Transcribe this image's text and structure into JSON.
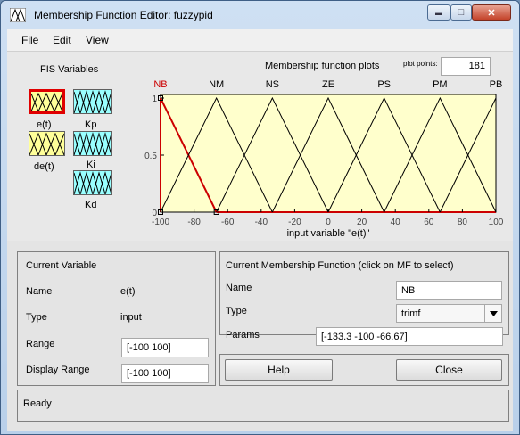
{
  "window": {
    "title": "Membership Function Editor: fuzzypid"
  },
  "controls": {
    "minimize": "▬",
    "maximize": "□",
    "close": "✕"
  },
  "menu": [
    "File",
    "Edit",
    "View"
  ],
  "fis_variables": {
    "title": "FIS Variables",
    "inputs": [
      {
        "name": "e(t)",
        "selected": true
      },
      {
        "name": "de(t)",
        "selected": false
      }
    ],
    "outputs": [
      {
        "name": "Kp"
      },
      {
        "name": "Ki"
      },
      {
        "name": "Kd"
      }
    ]
  },
  "plot": {
    "title": "Membership function plots",
    "plot_points_label": "plot points:",
    "plot_points_value": "181",
    "xlabel": "input variable \"e(t)\"",
    "x_ticks": [
      "-100",
      "-80",
      "-60",
      "-40",
      "-20",
      "0",
      "20",
      "40",
      "60",
      "80",
      "100"
    ],
    "y_ticks": [
      "1",
      "0.5",
      "0"
    ]
  },
  "chart_data": {
    "type": "line",
    "x_range": [
      -100,
      100
    ],
    "y_range": [
      0,
      1
    ],
    "selected": "NB",
    "series": [
      {
        "name": "NB",
        "params": [
          -133.3,
          -100,
          -66.67
        ]
      },
      {
        "name": "NM",
        "params": [
          -100,
          -66.67,
          -33.33
        ]
      },
      {
        "name": "NS",
        "params": [
          -66.67,
          -33.33,
          0
        ]
      },
      {
        "name": "ZE",
        "params": [
          -33.33,
          0,
          33.33
        ]
      },
      {
        "name": "PS",
        "params": [
          0,
          33.33,
          66.67
        ]
      },
      {
        "name": "PM",
        "params": [
          33.33,
          66.67,
          100
        ]
      },
      {
        "name": "PB",
        "params": [
          66.67,
          100,
          133.3
        ]
      }
    ]
  },
  "current_variable": {
    "title": "Current Variable",
    "name_label": "Name",
    "name_value": "e(t)",
    "type_label": "Type",
    "type_value": "input",
    "range_label": "Range",
    "range_value": "[-100 100]",
    "display_range_label": "Display Range",
    "display_range_value": "[-100 100]"
  },
  "current_mf": {
    "title": "Current Membership Function (click on MF to select)",
    "name_label": "Name",
    "name_value": "NB",
    "type_label": "Type",
    "type_value": "trimf",
    "params_label": "Params",
    "params_value": "[-133.3 -100 -66.67]"
  },
  "buttons": {
    "help": "Help",
    "close": "Close"
  },
  "status": "Ready",
  "colors": {
    "plot_bg": "#ffffcc",
    "selected_mf": "#cc0000",
    "input_var": "#ffff99",
    "output_var": "#99ffff"
  }
}
